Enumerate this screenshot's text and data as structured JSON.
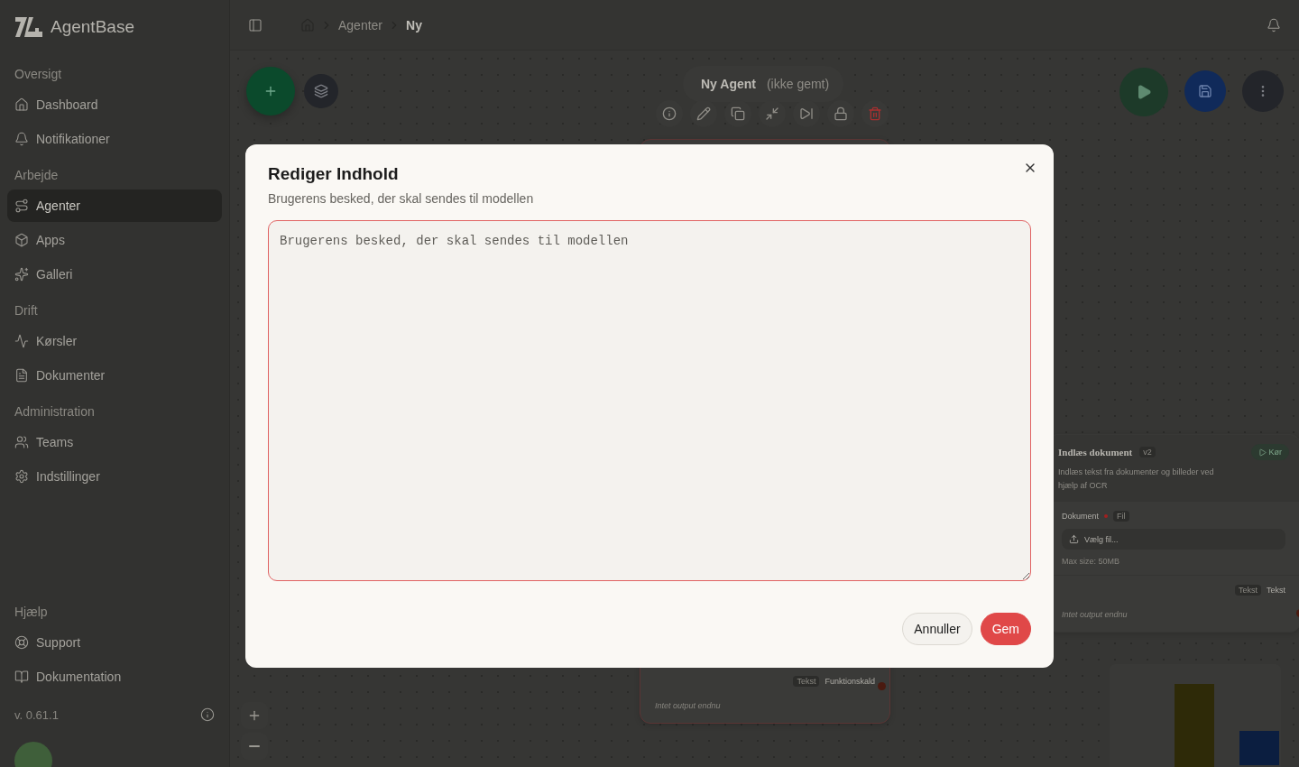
{
  "sidebar": {
    "brand": "AgentBase",
    "sections": [
      {
        "title": "Oversigt",
        "items": [
          {
            "label": "Dashboard",
            "selected": false
          },
          {
            "label": "Notifikationer",
            "selected": false
          }
        ]
      },
      {
        "title": "Arbejde",
        "items": [
          {
            "label": "Agenter",
            "selected": true
          },
          {
            "label": "Apps",
            "selected": false
          },
          {
            "label": "Galleri",
            "selected": false
          }
        ]
      },
      {
        "title": "Drift",
        "items": [
          {
            "label": "Kørsler",
            "selected": false
          },
          {
            "label": "Dokumenter",
            "selected": false
          }
        ]
      },
      {
        "title": "Administration",
        "items": [
          {
            "label": "Teams",
            "selected": false
          },
          {
            "label": "Indstillinger",
            "selected": false
          }
        ]
      }
    ],
    "help": {
      "title": "Hjælp",
      "items": [
        {
          "label": "Support",
          "selected": false
        },
        {
          "label": "Dokumentation",
          "selected": false
        }
      ]
    },
    "version": "v. 0.61.1"
  },
  "breadcrumb": [
    "Agenter",
    "Ny"
  ],
  "agent": {
    "name": "Ny Agent",
    "status": "(ikke gemt)"
  },
  "nodes": [
    {
      "kind": "document",
      "title": "Indlæs dokument",
      "version": "v2",
      "run": "Kør",
      "description": "Indlæs tekst fra dokumenter og billeder ved hjælp af OCR",
      "field": "Dokument",
      "field_type": "Fil",
      "upload": "Vælg fil...",
      "hint": "Max size: 50MB",
      "output_type": "Tekst",
      "output_label": "Tekst",
      "empty": "Intet output endnu"
    },
    {
      "kind": "function",
      "output_type": "Tekst",
      "output_label": "Funktionskald",
      "empty": "Intet output endnu"
    }
  ],
  "dialog": {
    "title": "Rediger Indhold",
    "description": "Brugerens besked, der skal sendes til modellen",
    "placeholder": "Brugerens besked, der skal sendes til modellen",
    "buttons": [
      {
        "kind": "cancel",
        "label": "Annuller"
      },
      {
        "kind": "save",
        "label": "Gem"
      }
    ]
  }
}
